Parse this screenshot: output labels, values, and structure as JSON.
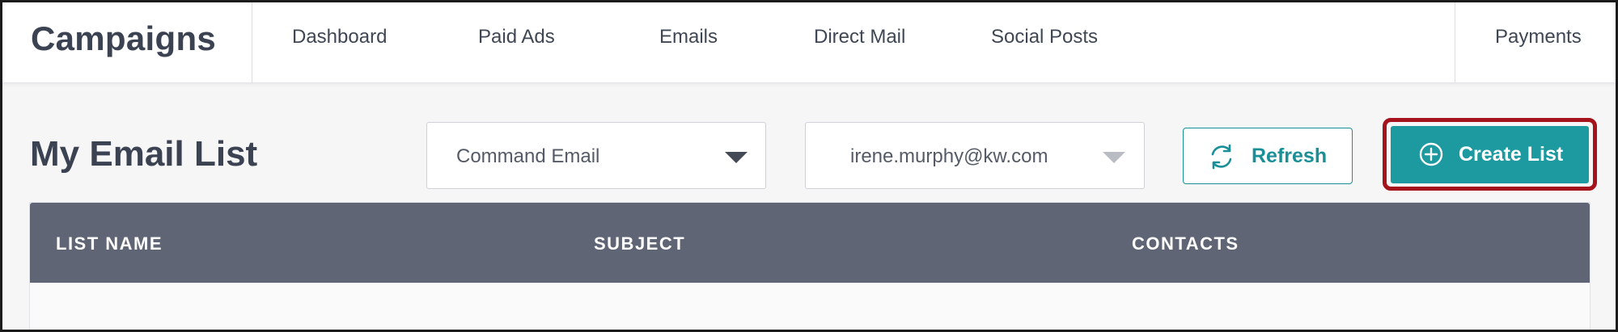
{
  "brand": "Campaigns",
  "nav": {
    "dashboard": "Dashboard",
    "paid_ads": "Paid Ads",
    "emails": "Emails",
    "direct_mail": "Direct Mail",
    "social_posts": "Social Posts",
    "payments": "Payments"
  },
  "page_title": "My Email List",
  "filters": {
    "source_select": {
      "value": "Command Email"
    },
    "account_select": {
      "value": "irene.murphy@kw.com"
    }
  },
  "buttons": {
    "refresh": "Refresh",
    "create_list": "Create List"
  },
  "table": {
    "columns": [
      "LIST NAME",
      "SUBJECT",
      "CONTACTS"
    ],
    "rows": []
  },
  "colors": {
    "accent": "#1c9aa0",
    "highlight": "#a5131c",
    "table_header": "#5f6574",
    "text_dark": "#3b4251"
  },
  "icons": {
    "refresh": "refresh-icon",
    "create": "plus-circle-icon",
    "dropdown": "chevron-down-icon"
  }
}
